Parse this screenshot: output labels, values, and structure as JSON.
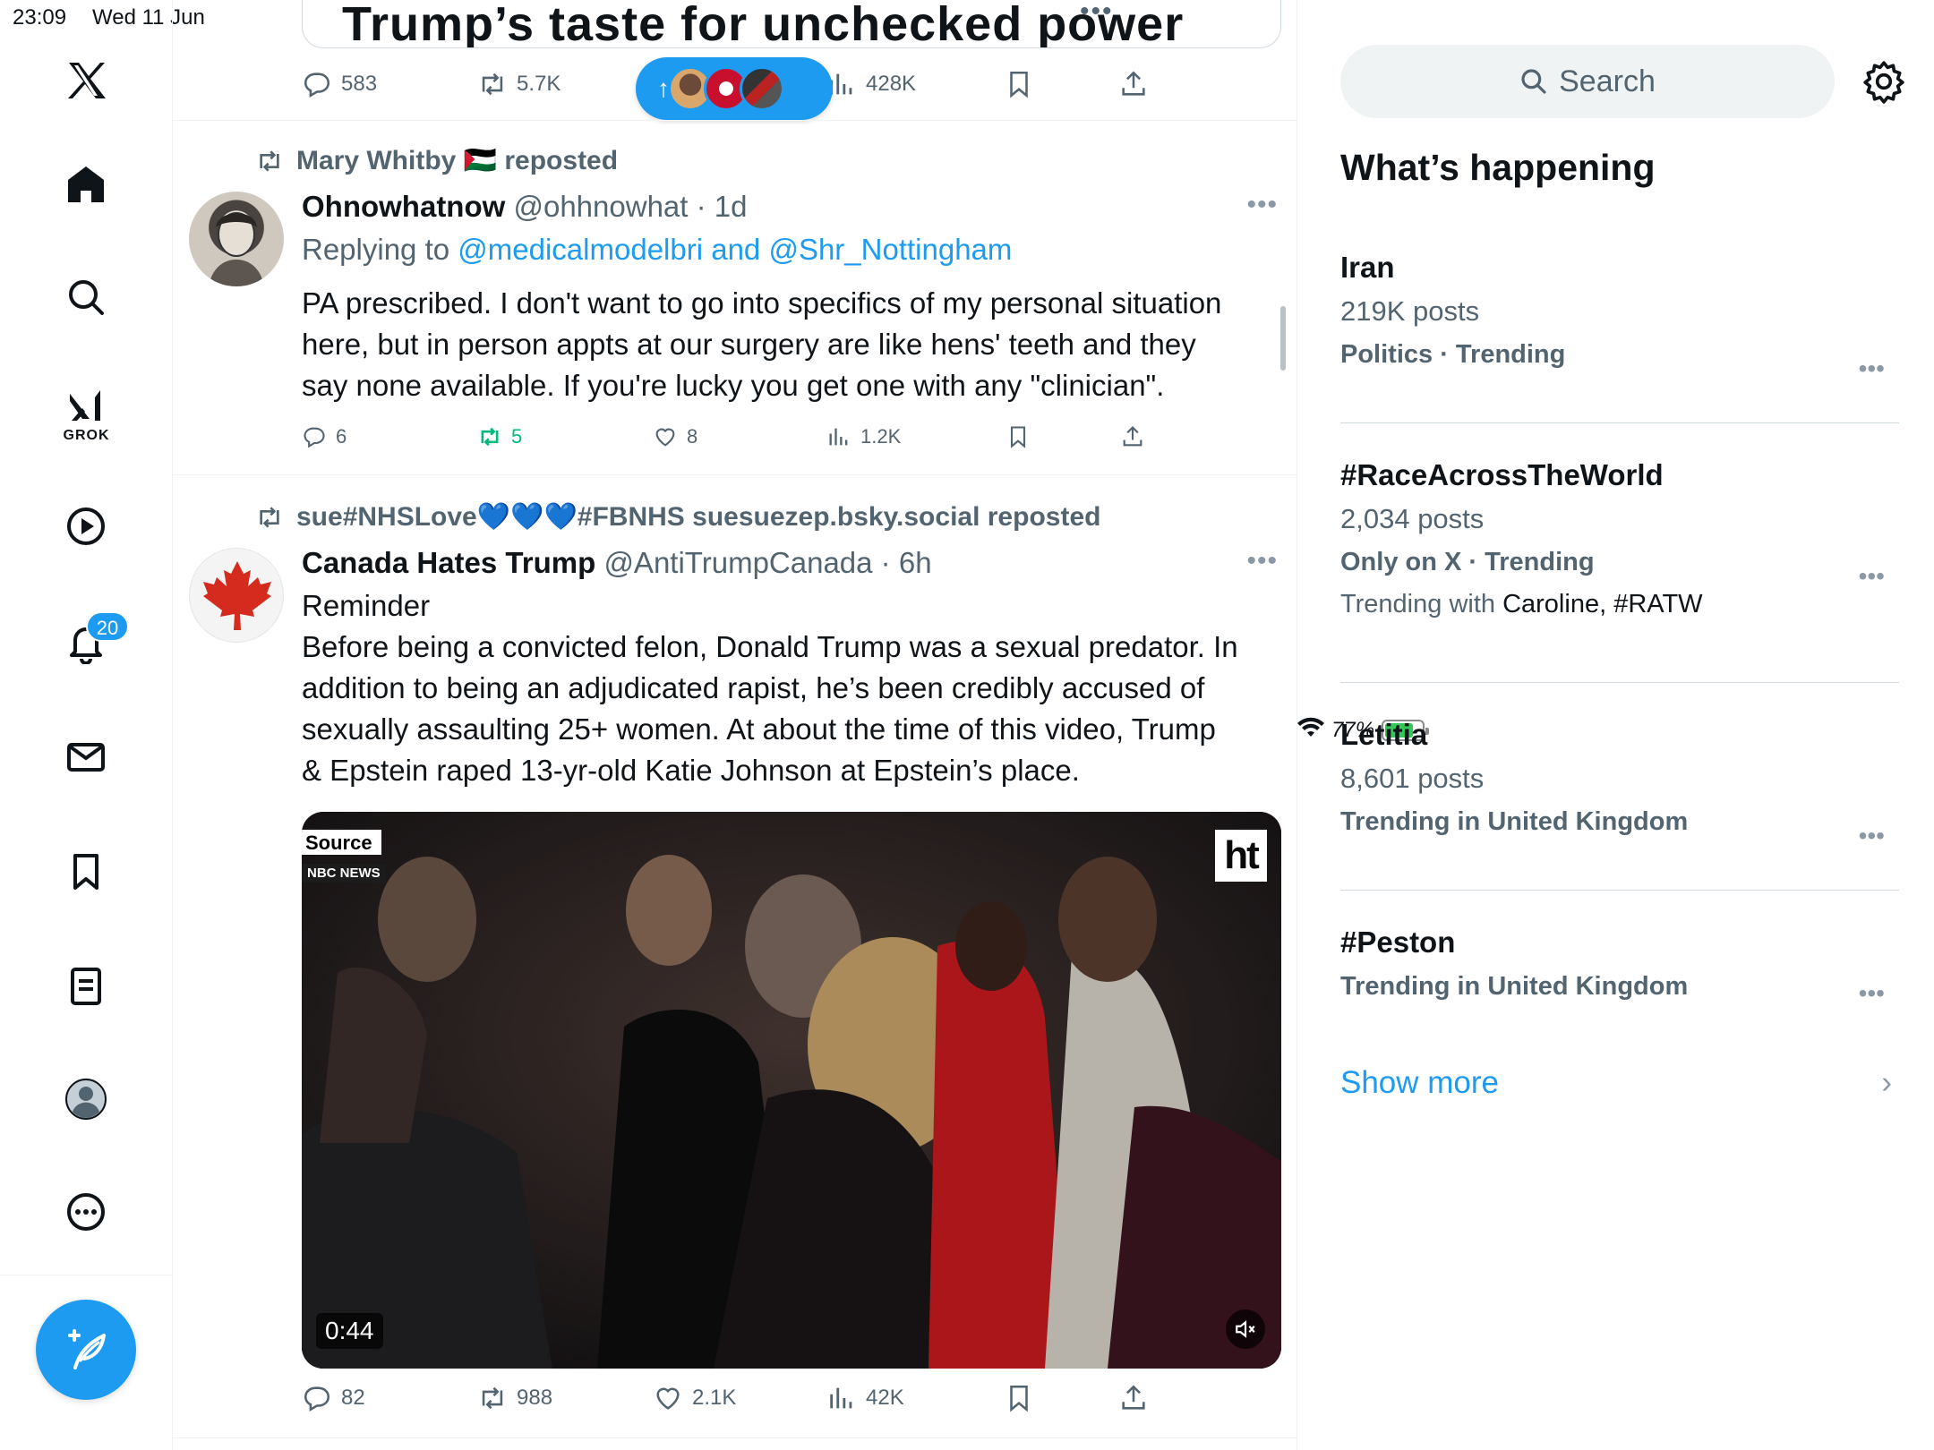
{
  "status_bar": {
    "time": "23:09",
    "date": "Wed 11 Jun",
    "battery_percent": "77%",
    "battery_level": 0.77
  },
  "nav": {
    "grok_label": "GROK",
    "notifications_count": "20"
  },
  "previous_tweet": {
    "headline": "Trump’s taste for unchecked power",
    "replies": "583",
    "reposts": "5.7K",
    "views": "428K"
  },
  "tweets": [
    {
      "social_context": "Mary Whitby 🇵🇸 reposted",
      "name": "Ohnowhatnow",
      "handle": "@ohhnowhat",
      "time": "1d",
      "replying_prefix": "Replying to",
      "replying_users": "@medicalmodelbri and @Shr_Nottingham",
      "body_lines": [
        "PA prescribed. I don't want to go into specifics of my personal situation",
        "here, but in person appts at our surgery are like hens' teeth and they",
        "say none available. If you're lucky you get one with any \"clinician\"."
      ],
      "replies": "6",
      "reposts": "5",
      "likes": "8",
      "views": "1.2K"
    },
    {
      "social_context": "sue#NHSLove💙💙💙#FBNHS suesuezep.bsky.social reposted",
      "name": "Canada Hates Trump",
      "handle": "@AntiTrumpCanada",
      "time": "6h",
      "body_lines": [
        "Reminder",
        "Before being a convicted felon, Donald Trump was a sexual predator. In",
        "addition to being an adjudicated rapist, he’s been credibly accused of",
        "sexually assaulting 25+ women. At about the time of this video, Trump",
        "& Epstein raped 13-yr-old Katie Johnson at Epstein’s place."
      ],
      "video": {
        "source_label": "Source",
        "source_name": "NBC NEWS",
        "logo": "ht",
        "duration": "0:44"
      },
      "replies": "82",
      "reposts": "988",
      "likes": "2.1K",
      "views": "42K"
    }
  ],
  "sidebar": {
    "search_placeholder": "Search",
    "title": "What’s happening",
    "trends": [
      {
        "title": "Iran",
        "posts": "219K posts",
        "category": "Politics · Trending"
      },
      {
        "title": "#RaceAcrossTheWorld",
        "posts": "2,034 posts",
        "category": "Only on X · Trending",
        "with_prefix": "Trending with",
        "with_terms": "Caroline, #RATW"
      },
      {
        "title": "Letitia",
        "posts": "8,601 posts",
        "category": "Trending in United Kingdom"
      },
      {
        "title": "#Peston",
        "category": "Trending in United Kingdom"
      }
    ],
    "show_more": "Show more"
  },
  "colors": {
    "accent": "#1d9bf0",
    "repost_green": "#00ba7c",
    "secondary_text": "#536471"
  }
}
